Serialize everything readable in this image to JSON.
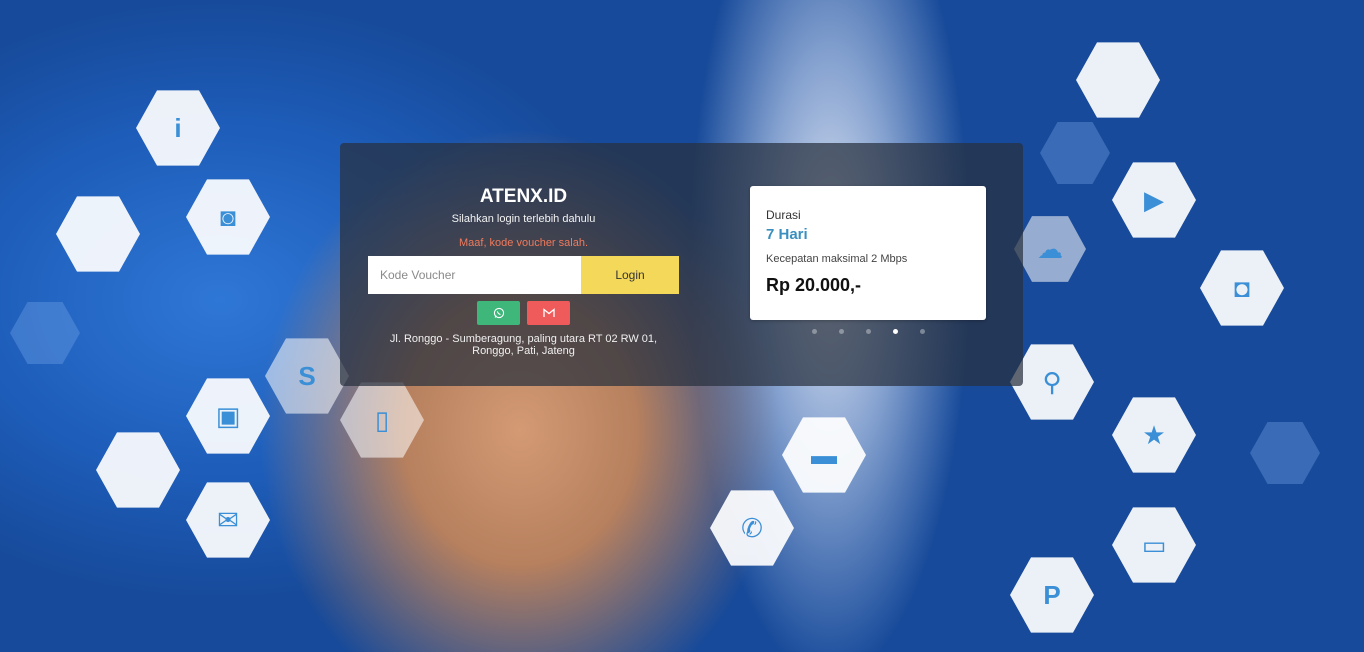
{
  "login": {
    "brand": "ATENX.ID",
    "subtitle": "Silahkan login terlebih dahulu",
    "error_message": "Maaf, kode voucher salah.",
    "voucher_placeholder": "Kode Voucher",
    "voucher_value": "",
    "login_label": "Login",
    "address": "Jl. Ronggo - Sumberagung, paling utara RT 02 RW 01, Ronggo, Pati, Jateng"
  },
  "contact": {
    "whatsapp_icon": "whatsapp-icon",
    "email_icon": "gmail-icon",
    "whatsapp_color": "#3fb77a",
    "email_color": "#ef5a5a"
  },
  "package": {
    "label": "Durasi",
    "duration": "7 Hari",
    "speed": "Kecepatan maksimal 2 Mbps",
    "price": "Rp 20.000,-"
  },
  "carousel": {
    "slide_count": 5,
    "active_index": 3
  },
  "colors": {
    "login_button": "#f4d85a",
    "error_text": "#f07a5c",
    "duration_text": "#3a8fbf"
  }
}
